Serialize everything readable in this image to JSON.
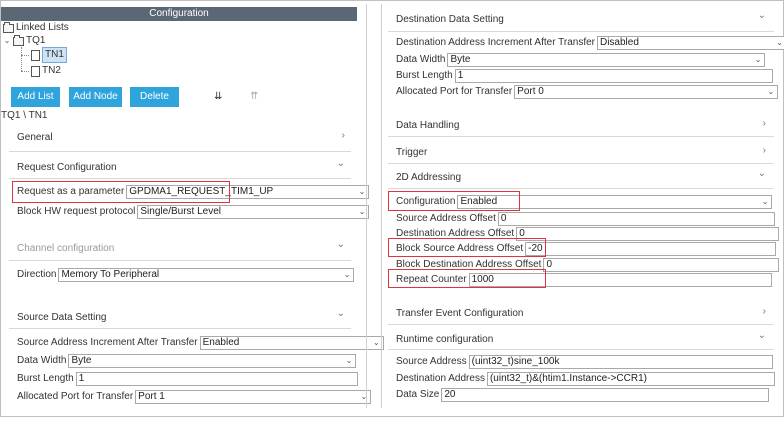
{
  "left": {
    "config_header": "Configuration",
    "tree": {
      "root": "Linked Lists",
      "queue": "TQ1",
      "nodes": [
        "TN1",
        "TN2"
      ]
    },
    "buttons": {
      "add_list": "Add List",
      "add_node": "Add Node",
      "delete": "Delete"
    },
    "breadcrumb": "TQ1 \\ TN1",
    "general": "General",
    "request_configuration": {
      "title": "Request Configuration",
      "request_label": "Request as a parameter",
      "request_value": "GPDMA1_REQUEST_TIM1_UP",
      "block_hw_label": "Block HW request protocol",
      "block_hw_value": "Single/Burst Level"
    },
    "channel_configuration": {
      "title": "Channel configuration",
      "direction_label": "Direction",
      "direction_value": "Memory To Peripheral"
    },
    "source_data_setting": {
      "title": "Source Data Setting",
      "increment_label": "Source Address Increment After Transfer",
      "increment_value": "Enabled",
      "width_label": "Data Width",
      "width_value": "Byte",
      "burst_label": "Burst Length",
      "burst_value": "1",
      "port_label": "Allocated Port for Transfer",
      "port_value": "Port 1"
    }
  },
  "right": {
    "destination_data_setting": {
      "title": "Destination Data Setting",
      "increment_label": "Destination Address Increment After Transfer",
      "increment_value": "Disabled",
      "width_label": "Data Width",
      "width_value": "Byte",
      "burst_label": "Burst Length",
      "burst_value": "1",
      "port_label": "Allocated Port for Transfer",
      "port_value": "Port 0"
    },
    "data_handling": "Data Handling",
    "trigger": "Trigger",
    "addressing_2d": {
      "title": "2D Addressing",
      "configuration_label": "Configuration",
      "configuration_value": "Enabled",
      "src_offset_label": "Source Address Offset",
      "src_offset_value": "0",
      "dst_offset_label": "Destination Address Offset",
      "dst_offset_value": "0",
      "block_src_offset_label": "Block Source Address Offset",
      "block_src_offset_value": "-20",
      "block_dst_offset_label": "Block Destination Address Offset",
      "block_dst_offset_value": "0",
      "repeat_label": "Repeat Counter",
      "repeat_value": "1000"
    },
    "transfer_event": "Transfer Event Configuration",
    "runtime_configuration": {
      "title": "Runtime configuration",
      "src_addr_label": "Source Address",
      "src_addr_value": "(uint32_t)sine_100k",
      "dst_addr_label": "Destination Address",
      "dst_addr_value": "(uint32_t)&(htim1.Instance->CCR1)",
      "size_label": "Data Size",
      "size_value": "20"
    }
  },
  "icons": {
    "chevron_right": "›",
    "chevron_down": "⌄",
    "dropdown": "⌄"
  },
  "colors": {
    "header_bg": "#5a6775",
    "button_bg": "#2fa4dc",
    "highlight": "#d9363e"
  }
}
